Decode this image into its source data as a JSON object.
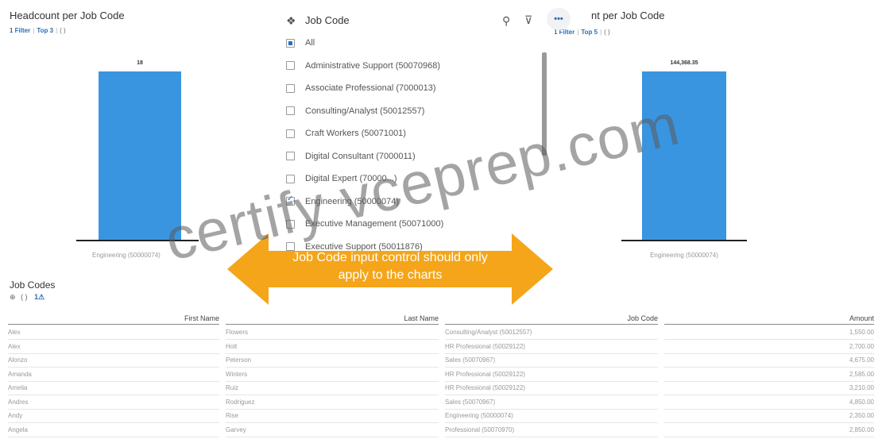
{
  "left_chart": {
    "title": "Headcount per Job Code",
    "filter_link": "1 Filter",
    "top_link": "Top 3",
    "braces": "( )",
    "value_label": "18",
    "category": "Engineering (50000074)"
  },
  "right_chart": {
    "title_visible": "nt per Job Code",
    "filter_link": "1 Filter",
    "top_link": "Top 5",
    "braces": "( )",
    "value_label": "144,368.35",
    "category": "Engineering (50000074)"
  },
  "chart_data": [
    {
      "type": "bar",
      "title": "Headcount per Job Code",
      "categories": [
        "Engineering (50000074)"
      ],
      "values": [
        18
      ]
    },
    {
      "type": "bar",
      "categories": [
        "Engineering (50000074)"
      ],
      "values": [
        144368.35
      ]
    }
  ],
  "dropdown": {
    "title": "Job Code",
    "more_label": "•••",
    "items": [
      {
        "label": "All",
        "state": "partial"
      },
      {
        "label": "Administrative Support (50070968)",
        "state": "unchecked"
      },
      {
        "label": "Associate Professional (7000013)",
        "state": "unchecked"
      },
      {
        "label": "Consulting/Analyst (50012557)",
        "state": "unchecked"
      },
      {
        "label": "Craft Workers (50071001)",
        "state": "unchecked"
      },
      {
        "label": "Digital Consultant (7000011)",
        "state": "unchecked"
      },
      {
        "label": "Digital Expert (70000...)",
        "state": "unchecked"
      },
      {
        "label": "Engineering (50000074)",
        "state": "checked"
      },
      {
        "label": "Executive Management (50071000)",
        "state": "unchecked"
      },
      {
        "label": "Executive Support (50011876)",
        "state": "unchecked"
      }
    ]
  },
  "annotation": {
    "text_line1": "Job Code input control should only",
    "text_line2": "apply to the charts",
    "color": "#f5a51a"
  },
  "watermark": "certify vceprep.com",
  "table": {
    "title": "Job Codes",
    "sub_icon": "⊕",
    "sub_braces": "( )",
    "sub_link": "1⚠",
    "columns": [
      "First Name",
      "Last Name",
      "Job Code",
      "Amount"
    ],
    "rows": [
      [
        "Alex",
        "Flowers",
        "Consulting/Analyst (50012557)",
        "1,550.00"
      ],
      [
        "Alex",
        "Holt",
        "HR Professional (50029122)",
        "2,700.00"
      ],
      [
        "Alonzo",
        "Peterson",
        "Sales (50070967)",
        "4,675.00"
      ],
      [
        "Amanda",
        "Winters",
        "HR Professional (50029122)",
        "2,585.00"
      ],
      [
        "Amelia",
        "Ruiz",
        "HR Professional (50029122)",
        "3,210.00"
      ],
      [
        "Andres",
        "Rodriguez",
        "Sales (50070967)",
        "4,850.00"
      ],
      [
        "Andy",
        "Rise",
        "Engineering (50000074)",
        "2,350.00"
      ],
      [
        "Angela",
        "Garvey",
        "Professional (50070970)",
        "2,850.00"
      ]
    ]
  }
}
